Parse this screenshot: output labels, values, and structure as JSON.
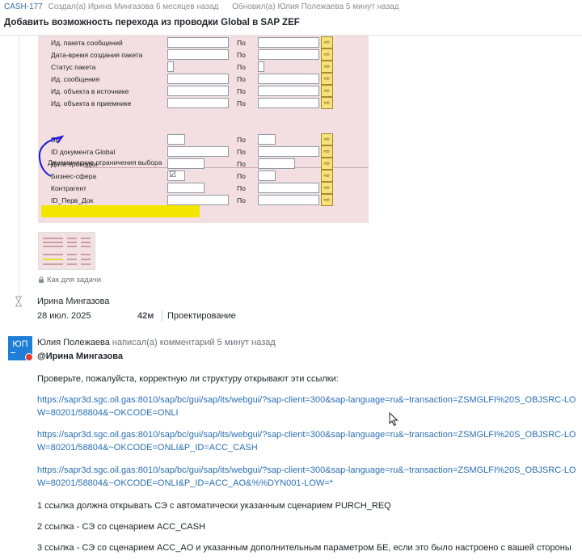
{
  "header": {
    "issue_key": "CASH-177",
    "created": "Создал(а) Ирина Мингазова 6 месяцев назад",
    "updated": "Обновил(а) Юлия Полежаева 5 минут назад",
    "title": "Добавить возможность перехода из проводки Global в SAP ZEF"
  },
  "sap": {
    "rows_top": [
      {
        "label": "Ид. пакета сообщений",
        "po": "По"
      },
      {
        "label": "Дата-время создания пакета",
        "po": "По"
      },
      {
        "label": "Статус пакета",
        "po": "По"
      },
      {
        "label": "Ид. сообщения",
        "po": "По"
      },
      {
        "label": "Ид. объекта в источнике",
        "po": "По"
      },
      {
        "label": "Ид. объекта в приемнике",
        "po": "По"
      }
    ],
    "section_title": "Динамические ограничения выбора",
    "rows_bottom": [
      {
        "label": "БЕ",
        "po": "По"
      },
      {
        "label": "ID документа Global",
        "po": "По"
      },
      {
        "label": "Дата проводки",
        "po": "По"
      },
      {
        "label": "Бизнес-сфера",
        "po": "По"
      },
      {
        "label": "Контрагент",
        "po": "По"
      },
      {
        "label": "ID_Перв_Док",
        "po": "По"
      }
    ],
    "check_value": "☑",
    "arrow_glyph": "⇨",
    "highlight_color": "#f2e600",
    "annotation_color": "#1a1adb"
  },
  "attachment": {
    "caption": "Как для задачи"
  },
  "worklog": {
    "author": "Ирина Мингазова",
    "date": "28 июл. 2025",
    "duration": "42м",
    "category": "Проектирование"
  },
  "comment": {
    "avatar_initials": "ЮП",
    "author": "Юлия Полежаева",
    "meta": "написал(а) комментарий 5 минут назад",
    "mention": "@Ирина Мингазова",
    "intro": "Проверьте, пожалуйста, корректную ли структуру открывают эти ссылки:",
    "links": [
      "https://sapr3d.sgc.oil.gas:8010/sap/bc/gui/sap/its/webgui/?sap-client=300&sap-language=ru&~transaction=ZSMGLFI%20S_OBJSRC-LOW=80201/58804&~OKCODE=ONLI",
      "https://sapr3d.sgc.oil.gas:8010/sap/bc/gui/sap/its/webgui/?sap-client=300&sap-language=ru&~transaction=ZSMGLFI%20S_OBJSRC-LOW=80201/58804&~OKCODE=ONLI&P_ID=ACC_CASH",
      "https://sapr3d.sgc.oil.gas:8010/sap/bc/gui/sap/its/webgui/?sap-client=300&sap-language=ru&~transaction=ZSMGLFI%20S_OBJSRC-LOW=80201/58804&~OKCODE=ONLI&P_ID=ACC_AO&%%DYN001-LOW=*"
    ],
    "notes": [
      "1 ссылка должна открывать СЭ с автоматически указанным сценарием PURCH_REQ",
      "2 ссылка - СЭ со сценарием ACC_CASH",
      "3 ссылка - СЭ со сценарием ACC_AO и указанным дополнительным параметром БЕ, если это было настроено с вашей стороны"
    ]
  }
}
